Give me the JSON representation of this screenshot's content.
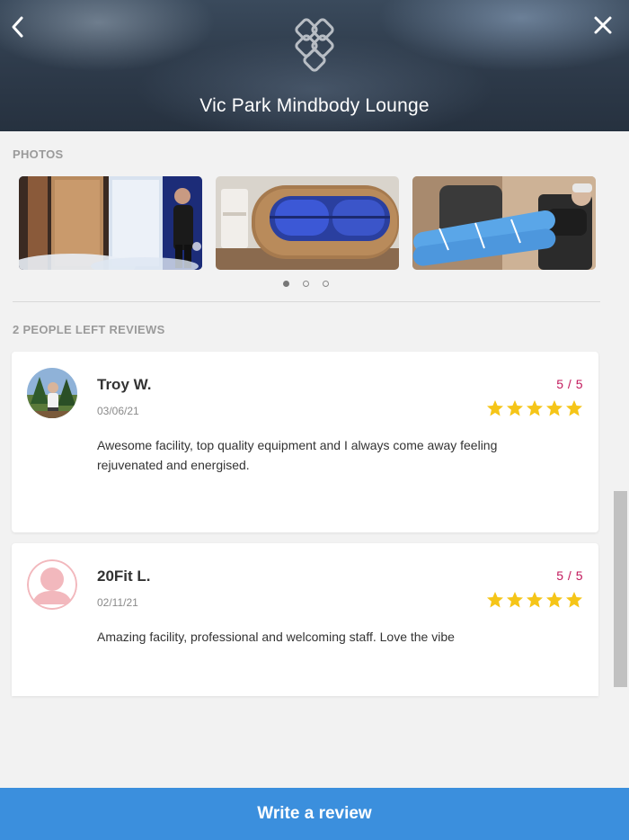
{
  "header": {
    "title": "Vic Park Mindbody Lounge",
    "back_icon": "chevron-left-icon",
    "close_icon": "close-icon",
    "logo_icon": "brand-logo"
  },
  "photos": {
    "section_label": "PHOTOS",
    "items": [
      {
        "name": "cryotherapy-chamber-photo"
      },
      {
        "name": "float-pod-photo"
      },
      {
        "name": "compression-therapy-photo"
      }
    ],
    "pagination": {
      "total": 3,
      "active_index": 1
    }
  },
  "reviews": {
    "section_label": "2 PEOPLE LEFT REVIEWS",
    "items": [
      {
        "name": "Troy W.",
        "date": "03/06/21",
        "rating_text": "5 / 5",
        "stars": 5,
        "text": "Awesome facility, top quality equipment and I always come away feeling rejuvenated and energised."
      },
      {
        "name": "20Fit L.",
        "date": "02/11/21",
        "rating_text": "5 / 5",
        "stars": 5,
        "text": "Amazing facility, professional and welcoming staff. Love the vibe"
      }
    ]
  },
  "footer": {
    "write_review_label": "Write a review"
  },
  "colors": {
    "accent_blue": "#3b8fdd",
    "rating_pink": "#c2185b",
    "star_yellow": "#f5c518"
  }
}
